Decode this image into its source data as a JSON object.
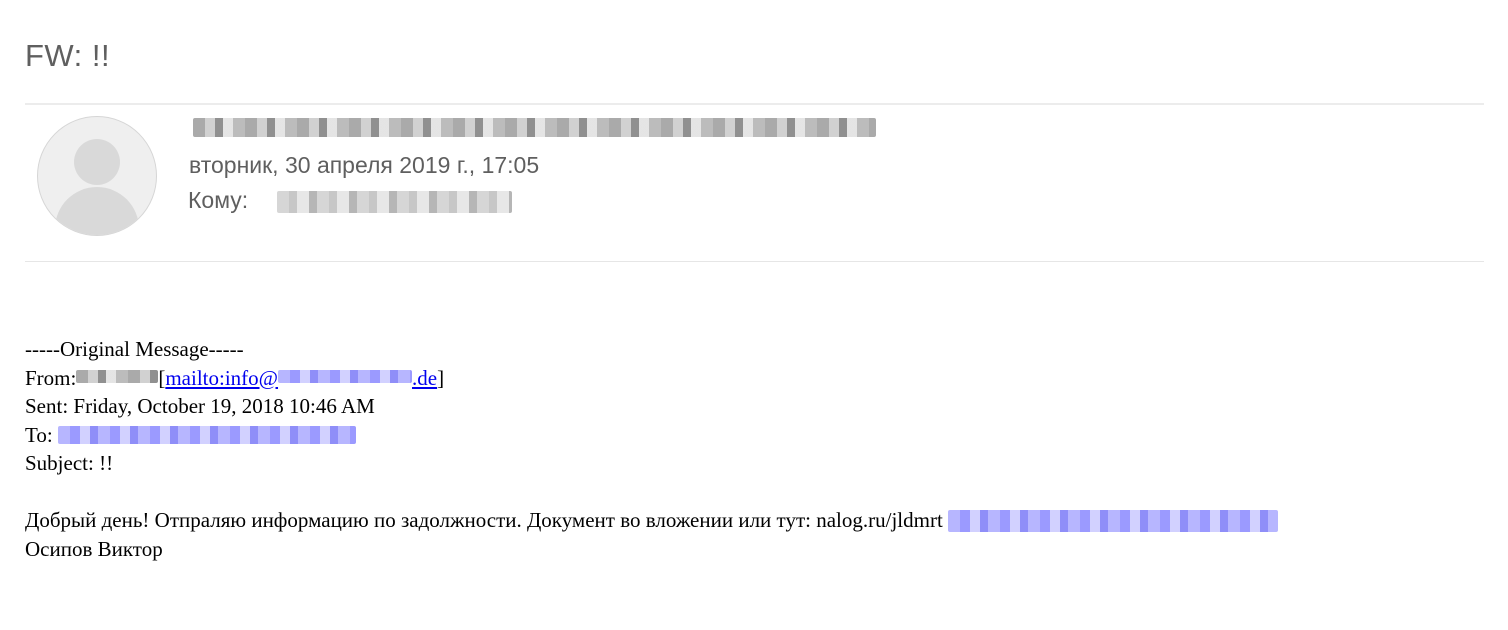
{
  "subject": "FW: !!",
  "header": {
    "date": "вторник, 30 апреля 2019 г., 17:05",
    "to_label": "Кому:"
  },
  "avatar_icon": "default-user-avatar-icon",
  "forwarded": {
    "separator": "-----Original Message-----",
    "from_label": "From:",
    "mailto_prefix": "mailto:info@",
    "mailto_suffix": ".de",
    "bracket_open": "[",
    "bracket_close": "]",
    "sent": "Sent: Friday, October 19, 2018 10:46 AM",
    "to_label": "To:",
    "subject": "Subject: !!"
  },
  "message": {
    "body": "Добрый день! Отпраляю информацию по задолжности. Документ во вложении или тут: nalog.ru/jldmrt",
    "signature": "Осипов Виктор"
  },
  "colors": {
    "link": "#0000ee",
    "header_text": "#5f5f5f",
    "redaction_link": "#9b9aff"
  }
}
